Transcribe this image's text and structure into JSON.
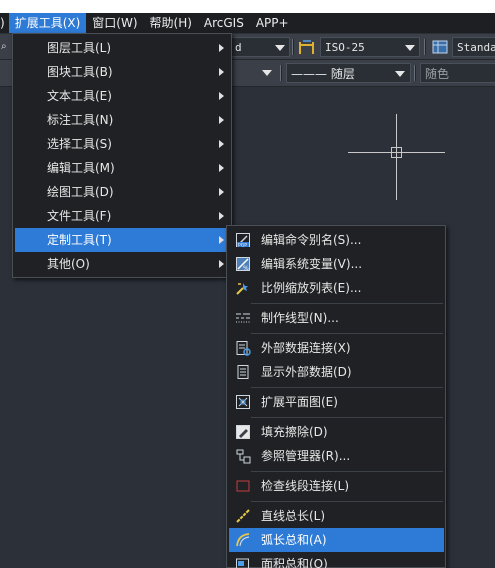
{
  "menubar": {
    "items": [
      {
        "label": ")"
      },
      {
        "label": "扩展工具(X)"
      },
      {
        "label": "窗口(W)"
      },
      {
        "label": "帮助(H)"
      },
      {
        "label": "ArcGIS"
      },
      {
        "label": "APP+"
      }
    ]
  },
  "toolbar": {
    "box1_value": "d",
    "dimstyle_value": "ISO-25",
    "textstyle_value": "Standar",
    "linetype_value": "——— 随层",
    "color_value": "随色"
  },
  "menu1": {
    "items": [
      {
        "label": "图层工具(L)"
      },
      {
        "label": "图块工具(B)"
      },
      {
        "label": "文本工具(E)"
      },
      {
        "label": "标注工具(N)"
      },
      {
        "label": "选择工具(S)"
      },
      {
        "label": "编辑工具(M)"
      },
      {
        "label": "绘图工具(D)"
      },
      {
        "label": "文件工具(F)"
      },
      {
        "label": "定制工具(T)"
      },
      {
        "label": "其他(O)"
      }
    ]
  },
  "menu2": {
    "items": [
      {
        "label": "编辑命令别名(S)...",
        "icon": "pgp-file-icon"
      },
      {
        "label": "编辑系统变量(V)...",
        "icon": "system-variable-icon"
      },
      {
        "label": "比例缩放列表(E)...",
        "icon": "scale-list-icon"
      },
      {
        "label": "制作线型(N)...",
        "icon": "linetype-icon"
      },
      {
        "label": "外部数据连接(X)",
        "icon": "external-data-link-icon"
      },
      {
        "label": "显示外部数据(D)",
        "icon": "show-external-data-icon"
      },
      {
        "label": "扩展平面图(E)",
        "icon": "expand-plan-icon"
      },
      {
        "label": "填充擦除(D)",
        "icon": "fill-erase-icon"
      },
      {
        "label": "参照管理器(R)...",
        "icon": "xref-manager-icon"
      },
      {
        "label": "检查线段连接(L)",
        "icon": "check-segment-icon"
      },
      {
        "label": "直线总长(L)",
        "icon": "line-length-icon"
      },
      {
        "label": "弧长总和(A)",
        "icon": "arc-length-icon"
      },
      {
        "label": "面积总和(O)",
        "icon": "area-sum-icon"
      }
    ]
  },
  "colors": {
    "accent": "#2d7bd6",
    "menu_bg": "#1f2124",
    "canvas_bg": "#2b3039"
  }
}
